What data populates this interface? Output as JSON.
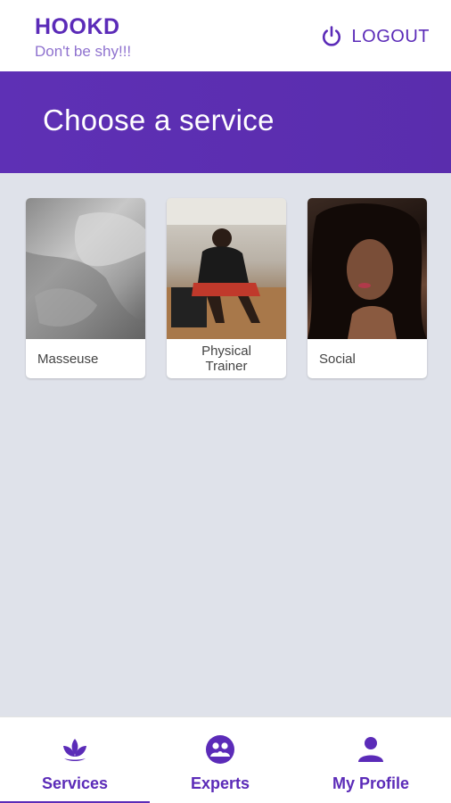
{
  "header": {
    "title": "HOOKD",
    "tagline": "Don't be shy!!!",
    "logout_label": "LOGOUT"
  },
  "hero": {
    "title": "Choose a service"
  },
  "services": [
    {
      "label": "Masseuse",
      "image": "masseuse-photo"
    },
    {
      "label": "Physical Trainer",
      "image": "trainer-photo"
    },
    {
      "label": "Social",
      "image": "social-photo"
    }
  ],
  "bottom_nav": {
    "items": [
      {
        "label": "Services",
        "icon": "lotus-icon",
        "active": true
      },
      {
        "label": "Experts",
        "icon": "people-circle-icon",
        "active": false
      },
      {
        "label": "My Profile",
        "icon": "person-icon",
        "active": false
      }
    ]
  },
  "colors": {
    "accent": "#5b2bb8",
    "tagline": "#8f72cf",
    "background": "#dfe2ea"
  }
}
